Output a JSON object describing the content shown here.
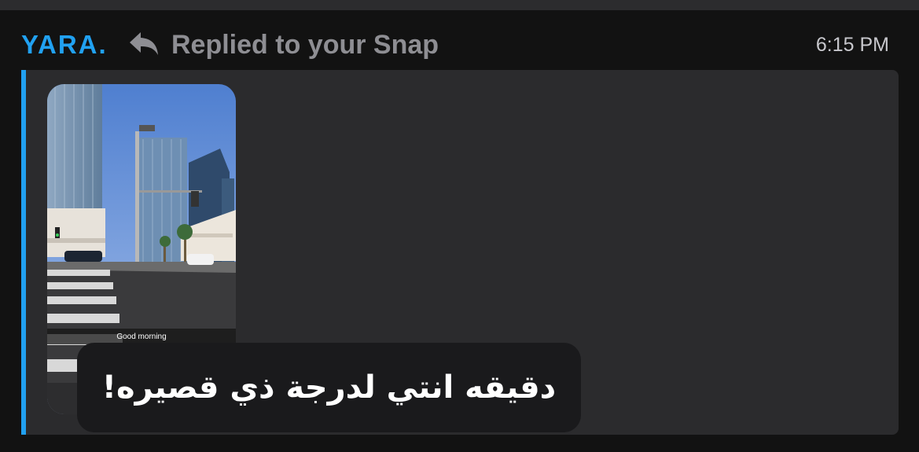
{
  "chat": {
    "sender_name": "YARA.",
    "reply_status": "Replied to your Snap",
    "timestamp": "6:15 PM",
    "reply_icon": "reply-arrow-icon",
    "accent_color": "#21a1f1"
  },
  "snap": {
    "caption": "Good morning",
    "scene": "city-street-photo"
  },
  "reply": {
    "text": "دقيقه انتي لدرجة ذي قصيره!"
  }
}
